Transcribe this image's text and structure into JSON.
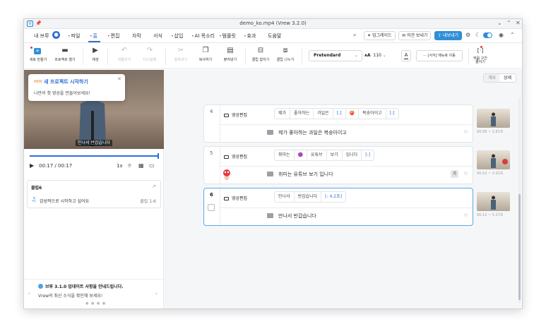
{
  "window": {
    "title": "demo_ko.mp4 (Vrew 3.2.0)"
  },
  "menu": {
    "items": [
      {
        "label": "내 브루",
        "dot": false
      },
      {
        "label": "파일",
        "dot": true
      },
      {
        "label": "홈",
        "dot": true
      },
      {
        "label": "편집",
        "dot": true
      },
      {
        "label": "자막",
        "dot": false
      },
      {
        "label": "서식",
        "dot": false
      },
      {
        "label": "삽입",
        "dot": true
      },
      {
        "label": "AI 목소리",
        "dot": true
      },
      {
        "label": "템플릿",
        "dot": true
      },
      {
        "label": "효과",
        "dot": true
      },
      {
        "label": "도움말",
        "dot": false
      }
    ],
    "active": "홈",
    "upgrade_label": "업그레이드",
    "feedback_label": "의견 보내기",
    "export_label": "내보내기"
  },
  "toolbar": {
    "new_project": "새로 만들기",
    "open_project": "프로젝트 열기",
    "play": "재생",
    "undo": "되돌리기",
    "redo": "다시실행",
    "cut": "잘라내기",
    "copy": "복사하기",
    "paste": "붙여넣기",
    "merge": "클립 합치기",
    "split": "클립 나누기",
    "font": "Pretendard",
    "size": "110",
    "color_label": "A",
    "format_menu": "[서식] 메뉴로 이동",
    "silence": "무음 구간 줄이기"
  },
  "preview": {
    "popup_badge": "NEW",
    "popup_title": "새 프로젝트 시작하기",
    "popup_sub": "나만의 첫 영상을 만들어보세요!",
    "caption": "만나서 반갑습니다",
    "progress": 1.0,
    "time_current": "00:17",
    "time_total": "/ 00:17",
    "speed": "1x"
  },
  "clip_panel": {
    "title": "클립6",
    "music": "감성적으로 시작하고 싶어요",
    "range": "클립 1-6"
  },
  "notice": {
    "title": "브루 3.1.0 업데이트 사항을 안내드립니다.",
    "sub": "Vrew의 최신 소식을 확인해 보세요!"
  },
  "view_toggle": {
    "simple": "개요",
    "detail": "상세",
    "active": "상세"
  },
  "clips": [
    {
      "num": "4",
      "type": "영상편집",
      "words": [
        {
          "t": "제가",
          "blue": false
        },
        {
          "t": "좋아하는",
          "blue": false
        },
        {
          "t": "과일은",
          "blue": false
        },
        {
          "t": "[-]",
          "blue": true
        },
        {
          "t": "🍑",
          "blue": false
        },
        {
          "t": "복숭아이고",
          "blue": false
        },
        {
          "t": "[-]",
          "blue": true
        }
      ],
      "sentence": "제가 좋아하는 과일은 복숭아이고",
      "time": "00:08 ~ 2.61초"
    },
    {
      "num": "5",
      "type": "영상편집",
      "words": [
        {
          "t": "취미는",
          "blue": false
        },
        {
          "t": "🟣",
          "blue": false
        },
        {
          "t": "유튜브",
          "blue": false
        },
        {
          "t": "보기",
          "blue": false
        },
        {
          "t": "입니다",
          "blue": false
        },
        {
          "t": "[-]",
          "blue": true
        }
      ],
      "sentence": "취미는 유튜브 보기 입니다",
      "ga": "가",
      "time": "00:10 ~ 2.02초"
    },
    {
      "num": "6",
      "type": "영상편집",
      "words": [
        {
          "t": "만나서",
          "blue": false
        },
        {
          "t": "반갑습니다",
          "blue": false
        },
        {
          "t": "[- 4.2초]",
          "blue": true
        }
      ],
      "sentence": "만나서 반갑습니다",
      "time": "00:12 ~ 5.27초"
    }
  ],
  "colors": {
    "accent": "#2f6fd6",
    "export": "#2f8fd8",
    "selected_border": "#5aa9e6"
  }
}
